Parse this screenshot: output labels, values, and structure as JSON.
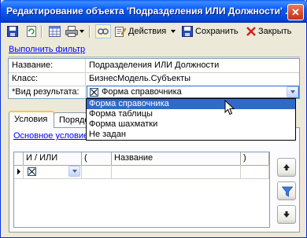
{
  "window": {
    "title": "Редактирование объекта 'Подразделения ИЛИ Должности' ...",
    "close_symbol": "✕"
  },
  "toolbar": {
    "actions_label": "Действия",
    "save_label": "Сохранить",
    "close_label": "Закрыть",
    "icons": [
      "save-icon",
      "refresh-icon",
      "table-icon",
      "print-icon",
      "link-icon",
      "actions-icon",
      "save-icon",
      "close-icon"
    ]
  },
  "filter": {
    "link_label": "Выполнить фильтр"
  },
  "properties": {
    "name_label": "Название:",
    "name_value": "Подразделения ИЛИ Должности",
    "class_label": "Класс:",
    "class_value": "БизнесМодель.Субъекты",
    "result_view_label": "Вид результата:",
    "result_view_marker": "*",
    "result_view_value": "Форма справочника"
  },
  "dropdown": {
    "options": [
      "Форма справочника",
      "Форма таблицы",
      "Форма шахматки",
      "Не задан"
    ],
    "selected_index": 0
  },
  "tabs": {
    "items": [
      "Условия",
      "Порядок"
    ],
    "active_index": 0
  },
  "conditions": {
    "link_label": "Основное условие",
    "columns": [
      "И / ИЛИ",
      "(",
      "Название",
      ")"
    ],
    "rows": [
      {
        "and_or": ""
      }
    ]
  },
  "side_buttons": [
    "move-up-icon",
    "filter-icon",
    "move-down-icon"
  ],
  "colors": {
    "titlebar": "#0a5ef5",
    "selection": "#316ac5",
    "link": "#0000ff",
    "window_bg": "#ece9d8"
  }
}
